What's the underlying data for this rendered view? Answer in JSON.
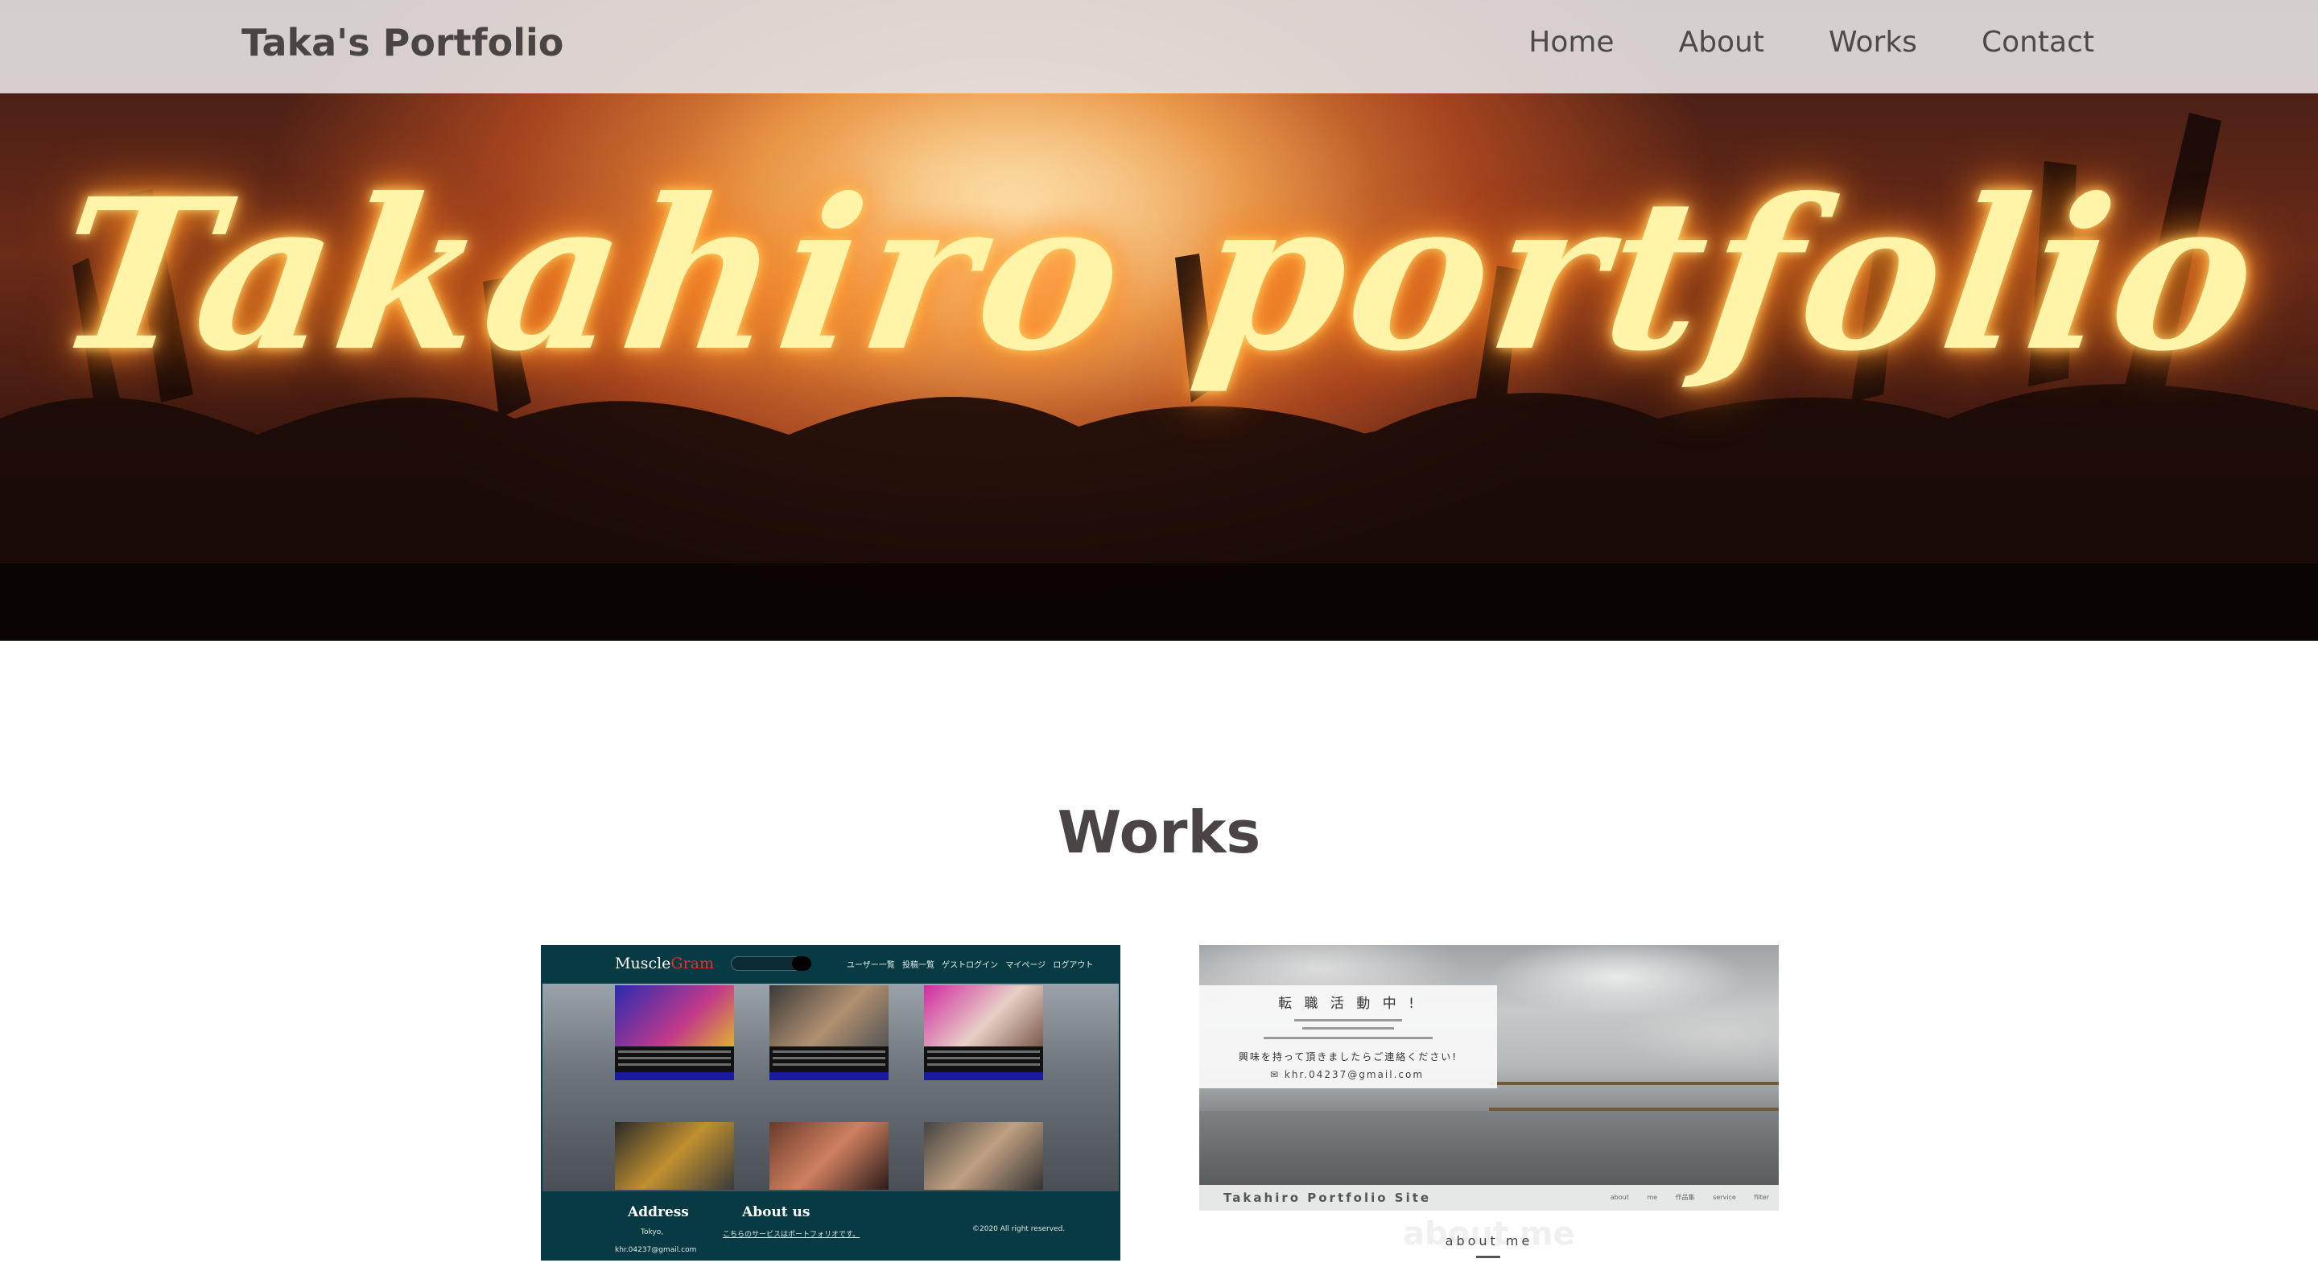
{
  "header": {
    "logo": "Taka's Portfolio",
    "nav": [
      "Home",
      "About",
      "Works",
      "Contact"
    ]
  },
  "hero": {
    "title": "Takahiro portfolio"
  },
  "works": {
    "heading": "Works",
    "cards": [
      {
        "brand_a": "Muscle",
        "brand_b": "Gram",
        "nav_text": "ユーザー一覧 投稿一覧 ゲストログイン マイページ ログアウト",
        "footer_address": "Address",
        "footer_about": "About us",
        "footer_city": "Tokyo,",
        "footer_email": "khr.04237@gmail.com",
        "footer_note": "こちらのサービスはポートフォリオです。",
        "footer_copy": "©2020 All right reserved."
      },
      {
        "box_title": "転 職 活 動 中 !",
        "box_message": "興味を持って頂きましたらご連絡ください!",
        "box_email": "khr.04237@gmail.com",
        "site_name": "Takahiro Portfolio Site",
        "links": "about me 作品集 service filter",
        "below_heading": "about me",
        "below_small": "about me"
      }
    ]
  },
  "colors": {
    "header_bg": "#e2dede",
    "text_dark": "#4a4444",
    "hero_glow": "#fff4a8",
    "musclegram_bg": "#073a42"
  }
}
